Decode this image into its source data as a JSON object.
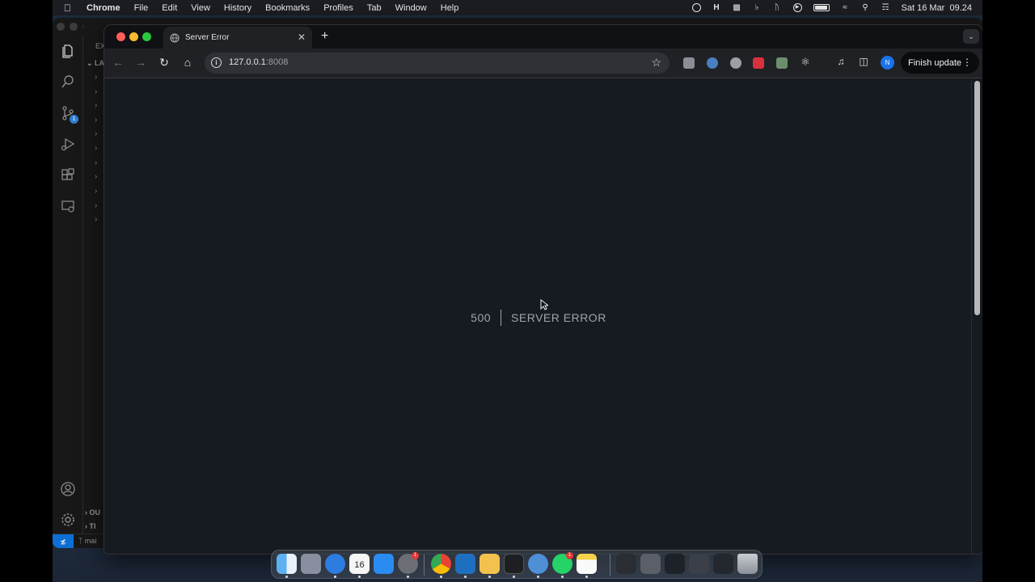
{
  "menubar": {
    "app_name": "Chrome",
    "items": [
      "File",
      "Edit",
      "View",
      "History",
      "Bookmarks",
      "Profiles",
      "Tab",
      "Window",
      "Help"
    ],
    "clock": "Sat 16 Mar  09.24"
  },
  "vscode": {
    "explorer_header": "EX",
    "section_label": "LA",
    "bottom_sections": [
      "OU",
      "TI"
    ],
    "branch": "mai",
    "scm_badge": "1"
  },
  "browser": {
    "tab_title": "Server Error",
    "url_host": "127.0.0.1",
    "url_port": ":8008",
    "finish_update": "Finish update",
    "profile_initial": "N"
  },
  "page": {
    "error_code": "500",
    "error_message": "SERVER ERROR"
  },
  "dock": {
    "calendar_day": "16",
    "calendar_month": "MAR",
    "whatsapp_badge": "1",
    "settings_badge": "1"
  },
  "colors": {
    "page_background": "#161a21",
    "error_text": "#a0a4ab",
    "accent_blue": "#1a73e8"
  }
}
